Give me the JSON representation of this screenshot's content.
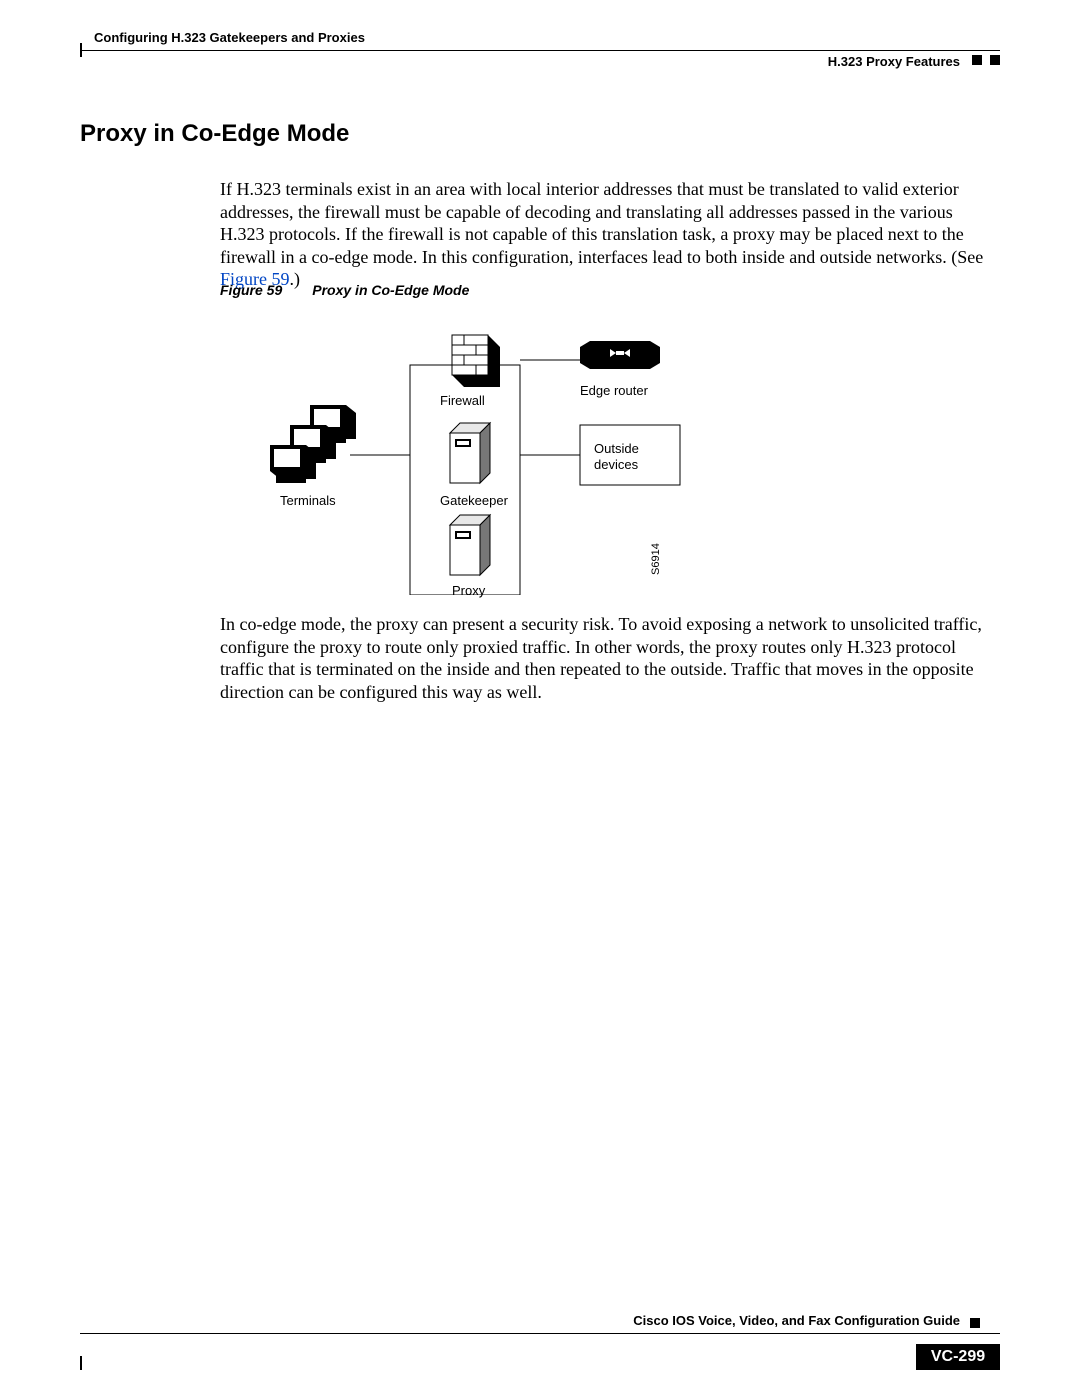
{
  "header": {
    "chapter": "Configuring H.323 Gatekeepers and Proxies",
    "section": "H.323 Proxy Features"
  },
  "title": "Proxy in Co-Edge Mode",
  "para1a": "If H.323 terminals exist in an area with local interior addresses that must be translated to valid exterior addresses, the firewall must be capable of decoding and translating all addresses passed in the various H.323 protocols. If the firewall is not capable of this translation task, a proxy may be placed next to the firewall in a co-edge mode. In this configuration, interfaces lead to both inside and outside networks. (See ",
  "figlink": "Figure 59",
  "para1b": ".)",
  "figure": {
    "caption_label": "Figure 59",
    "caption_title": "Proxy in Co-Edge Mode",
    "labels": {
      "firewall": "Firewall",
      "edge_router": "Edge router",
      "terminals": "Terminals",
      "gatekeeper": "Gatekeeper",
      "outside": "Outside",
      "devices": "devices",
      "proxy": "Proxy",
      "sidecode": "S6914"
    }
  },
  "para2": "In co-edge mode, the proxy can present a security risk. To avoid exposing a network to unsolicited traffic, configure the proxy to route only proxied traffic. In other words, the proxy routes only H.323 protocol traffic that is terminated on the inside and then repeated to the outside. Traffic that moves in the opposite direction can be configured this way as well.",
  "footer": {
    "guide": "Cisco IOS Voice, Video, and Fax Configuration Guide",
    "page": "VC-299"
  }
}
